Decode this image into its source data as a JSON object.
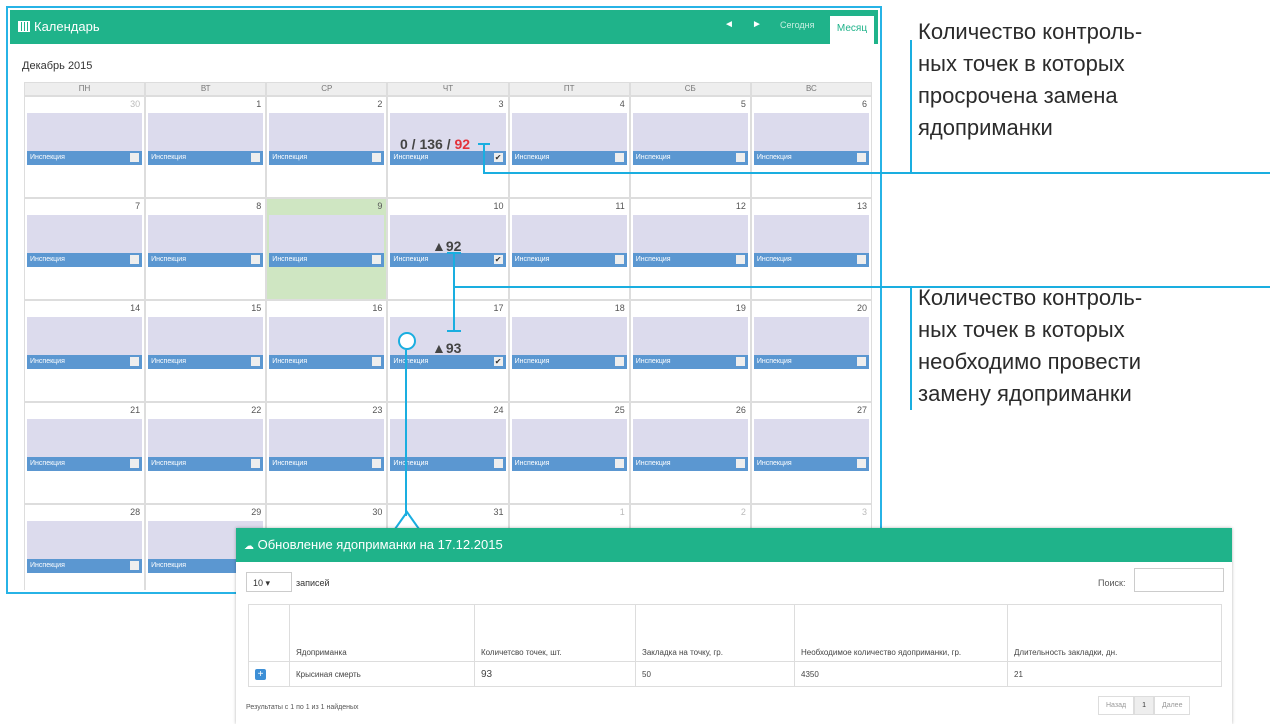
{
  "calendar": {
    "title": "Календарь",
    "today_label": "Сегодня",
    "month_label": "Месяц",
    "prev_icon": "◄",
    "next_icon": "►",
    "month_caption": "Декабрь 2015",
    "dow": [
      "ПН",
      "ВТ",
      "СР",
      "ЧТ",
      "ПТ",
      "СБ",
      "ВС"
    ],
    "event_label": "Инспекция",
    "weeks": [
      [
        "30",
        "1",
        "2",
        "3",
        "4",
        "5",
        "6"
      ],
      [
        "7",
        "8",
        "9",
        "10",
        "11",
        "12",
        "13"
      ],
      [
        "14",
        "15",
        "16",
        "17",
        "18",
        "19",
        "20"
      ],
      [
        "21",
        "22",
        "23",
        "24",
        "25",
        "26",
        "27"
      ],
      [
        "28",
        "29",
        "30",
        "31",
        "1",
        "2",
        "3"
      ]
    ],
    "labels": {
      "dec3_a": "0 / 136 / ",
      "dec3_b": "92",
      "dec10": "▲92",
      "dec17": "▲93"
    },
    "colors": {
      "header": "#1fb38a",
      "event": "#dcdbed",
      "event_bar": "#5b97d1",
      "today": "#cfe6c2",
      "red": "#e3323b"
    }
  },
  "annotations": {
    "overdue": "Количество контроль-\nных точек в которых\nпросрочена замена\nядоприманки",
    "required": "Количество контроль-\nных точек в которых\nнеобходимо провести\nзамену ядоприманки"
  },
  "popup": {
    "title": "Обновление ядоприманки на 17.12.2015",
    "entries_value": "10",
    "entries_label": "записей",
    "search_label": "Поиск:",
    "columns": [
      "Ядоприманка",
      "Количетсво точек, шт.",
      "Закладка на точку, гр.",
      "Необходимое количество ядоприманки, гр.",
      "Длительность закладки, дн."
    ],
    "rows": [
      [
        "Крысиная смерть",
        "93",
        "50",
        "4350",
        "21"
      ]
    ],
    "result_text": "Результаты с 1 по 1 из 1 найденых",
    "pagination": {
      "prev": "Назад",
      "page": "1",
      "next": "Далее"
    }
  }
}
